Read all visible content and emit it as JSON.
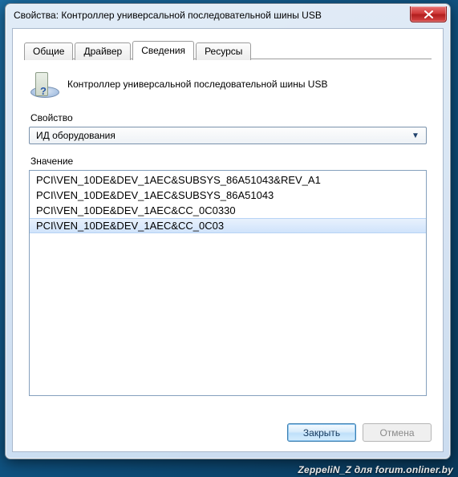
{
  "window": {
    "title": "Свойства: Контроллер универсальной последовательной шины USB"
  },
  "tabs": [
    {
      "label": "Общие",
      "active": false
    },
    {
      "label": "Драйвер",
      "active": false
    },
    {
      "label": "Сведения",
      "active": true
    },
    {
      "label": "Ресурсы",
      "active": false
    }
  ],
  "device": {
    "name": "Контроллер универсальной последовательной шины USB",
    "icon": "device-help-icon"
  },
  "property": {
    "label": "Свойство",
    "selected": "ИД оборудования"
  },
  "value": {
    "label": "Значение",
    "items": [
      "PCI\\VEN_10DE&DEV_1AEC&SUBSYS_86A51043&REV_A1",
      "PCI\\VEN_10DE&DEV_1AEC&SUBSYS_86A51043",
      "PCI\\VEN_10DE&DEV_1AEC&CC_0C0330",
      "PCI\\VEN_10DE&DEV_1AEC&CC_0C03"
    ],
    "selected_index": 3
  },
  "buttons": {
    "close": "Закрыть",
    "cancel": "Отмена"
  },
  "watermark": "ZeppeliN_Z для forum.onliner.by"
}
